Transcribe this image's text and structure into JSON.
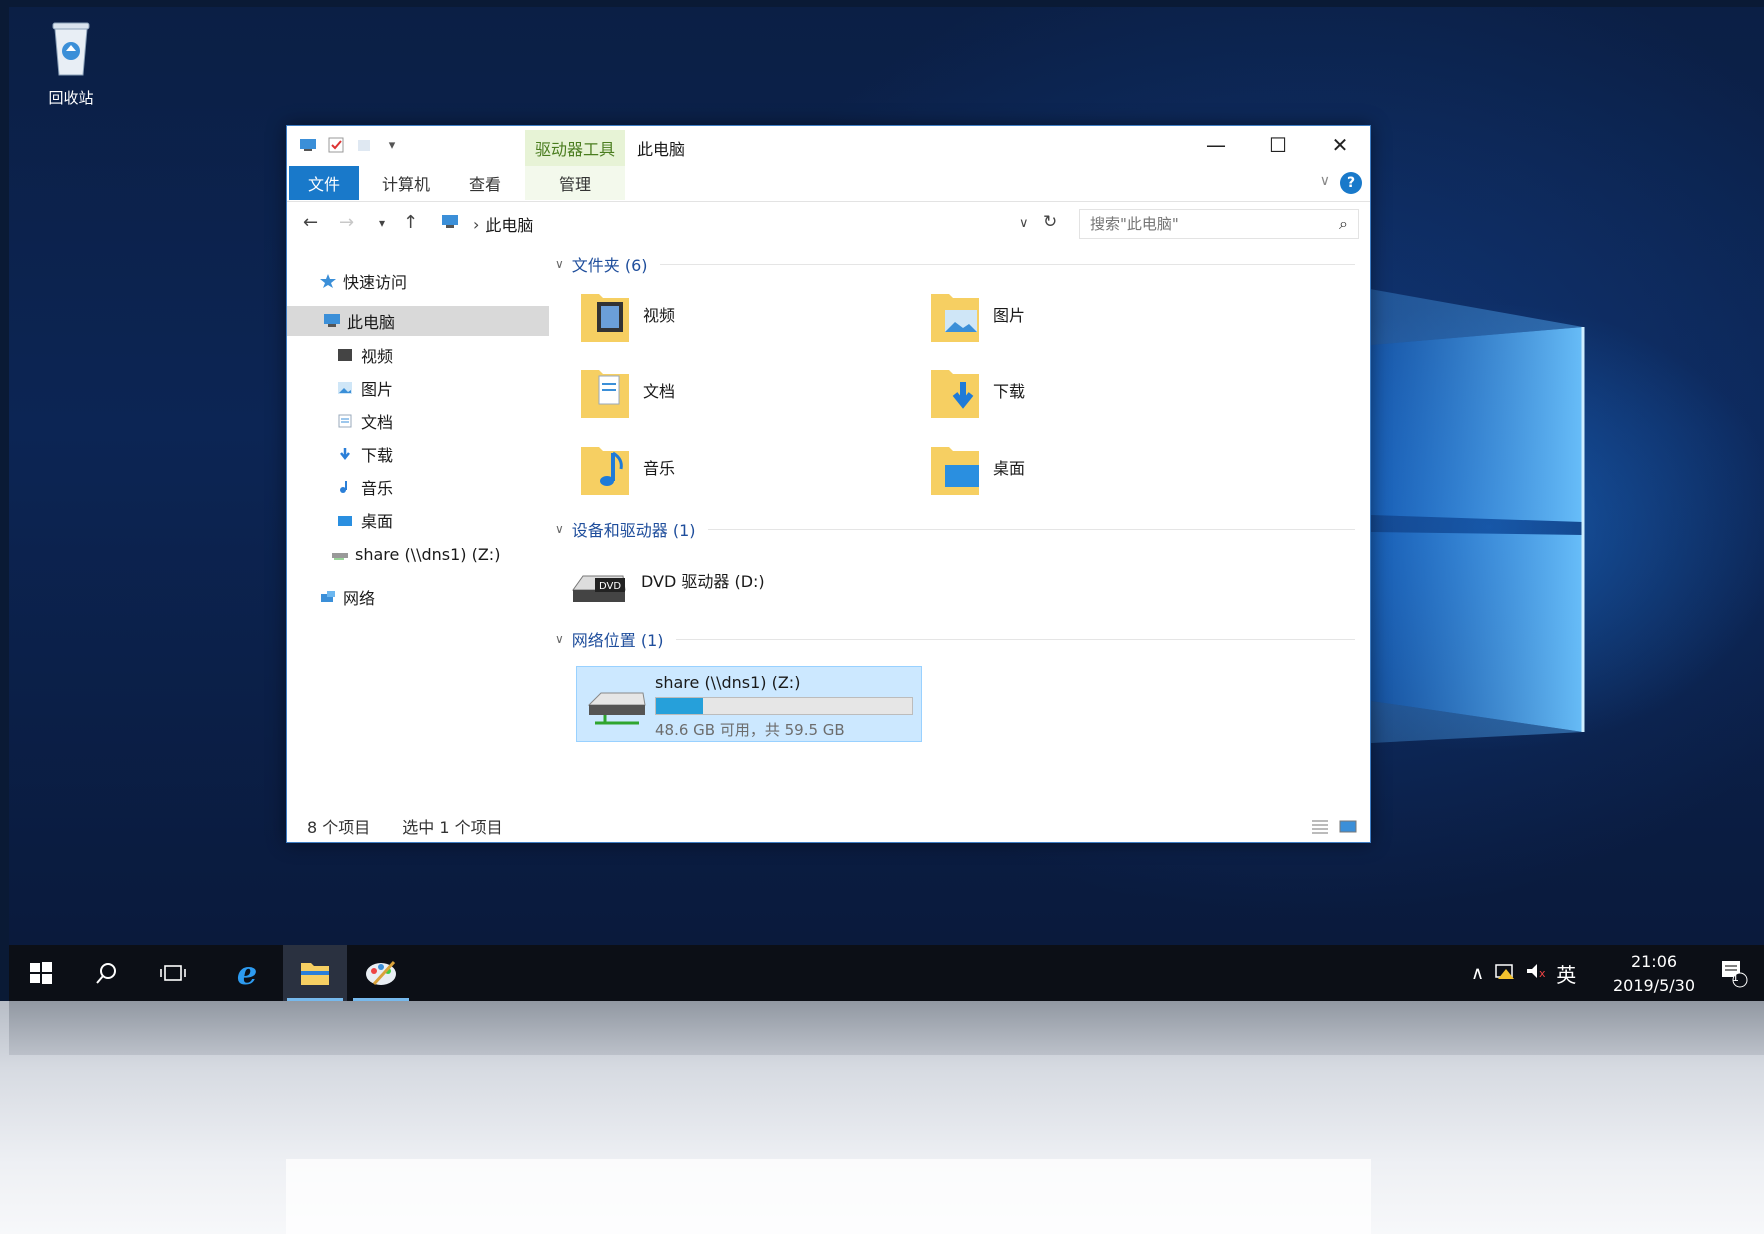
{
  "desktop": {
    "recycle_bin_label": "回收站"
  },
  "window": {
    "contextual_tab": "驱动器工具",
    "title": "此电脑",
    "ribbon_tabs": {
      "file": "文件",
      "computer": "计算机",
      "view": "查看",
      "manage": "管理"
    },
    "address": {
      "location": "此电脑"
    },
    "search": {
      "placeholder": "搜索\"此电脑\""
    }
  },
  "nav_pane": {
    "quick_access": "快速访问",
    "this_pc": "此电脑",
    "items": [
      "视频",
      "图片",
      "文档",
      "下载",
      "音乐",
      "桌面"
    ],
    "share_drive": "share (\\\\dns1) (Z:)",
    "network": "网络"
  },
  "groups": {
    "folders": {
      "title": "文件夹 (6)",
      "items": [
        "视频",
        "图片",
        "文档",
        "下载",
        "音乐",
        "桌面"
      ]
    },
    "devices": {
      "title": "设备和驱动器 (1)",
      "dvd": "DVD 驱动器 (D:)"
    },
    "network": {
      "title": "网络位置 (1)",
      "drive_name": "share (\\\\dns1) (Z:)",
      "space_text": "48.6 GB 可用，共 59.5 GB",
      "used_fraction": 0.183
    }
  },
  "status": {
    "count": "8 个项目",
    "selection": "选中 1 个项目"
  },
  "taskbar": {
    "input_method": "英",
    "time": "21:06",
    "date": "2019/5/30",
    "notification_count": "1"
  },
  "colors": {
    "accent": "#1979ca",
    "selected_tile": "#cce8ff",
    "progress": "#26a0da",
    "context_tab": "#4a7d1f"
  }
}
